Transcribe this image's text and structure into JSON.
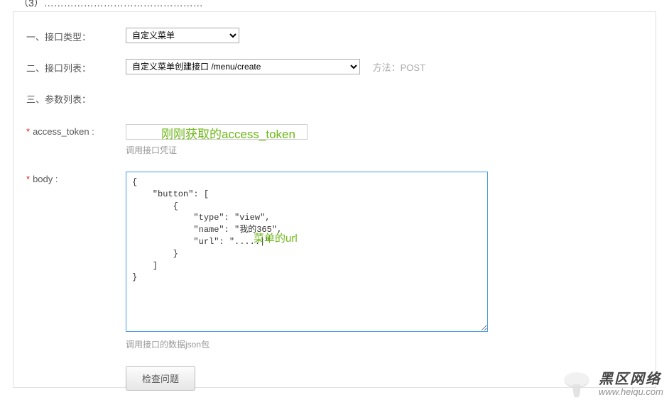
{
  "top_text": "（3）…………………………………………",
  "rows": {
    "type": {
      "label": "一、接口类型：",
      "value": "自定义菜单"
    },
    "api": {
      "label": "二、接口列表：",
      "value": "自定义菜单创建接口 /menu/create",
      "method_prefix": "方法：",
      "method": "POST"
    },
    "params": {
      "label": "三、参数列表："
    },
    "access_token": {
      "label": "access_token :",
      "value": "",
      "hint": "调用接口凭证",
      "annotation": "刚刚获取的access_token"
    },
    "body": {
      "label": "body :",
      "value": "{\n    \"button\": [\n        {\n            \"type\": \"view\",\n            \"name\": \"我的365\",\n            \"url\": \".....|\"\n        }\n    ]\n}",
      "hint": "调用接口的数据json包",
      "annotation": "菜单的url"
    }
  },
  "button": {
    "check_label": "检查问题"
  },
  "watermark": {
    "line1": "黑区网络",
    "line2": "www.heiqu.com"
  }
}
